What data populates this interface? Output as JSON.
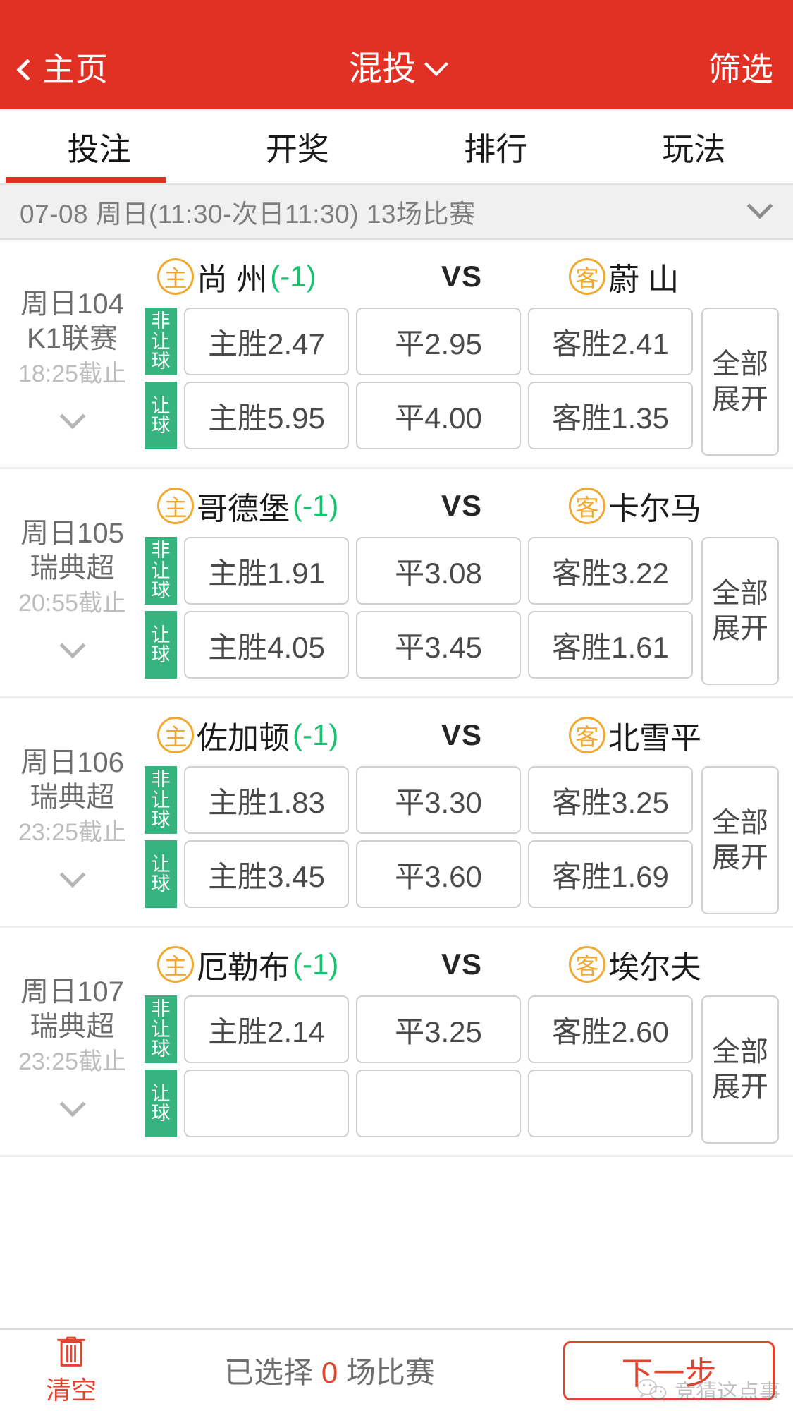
{
  "header": {
    "back_label": "主页",
    "title": "混投",
    "filter_label": "筛选",
    "back_icon": "chevron-left-icon",
    "title_icon": "chevron-down-icon",
    "bg_color": "#e03124"
  },
  "tabs": {
    "items": [
      {
        "label": "投注",
        "active": true
      },
      {
        "label": "开奖",
        "active": false
      },
      {
        "label": "排行",
        "active": false
      },
      {
        "label": "玩法",
        "active": false
      }
    ],
    "active_color": "#e03124"
  },
  "datebar": {
    "text": "07-08 周日(11:30-次日11:30) 13场比赛",
    "icon": "chevron-down-icon"
  },
  "labels": {
    "home_badge": "主",
    "away_badge": "客",
    "vs": "VS",
    "expand_line1": "全部",
    "expand_line2": "展开",
    "tag_nonhandicap": [
      "非",
      "让",
      "球"
    ],
    "tag_handicap": [
      "让",
      "球"
    ]
  },
  "matches": [
    {
      "no": "周日104",
      "league": "K1联赛",
      "cutoff": "18:25截止",
      "home_team": "尚 州",
      "handicap": "(-1)",
      "away_team": "蔚 山",
      "rows": [
        {
          "type": "非让球",
          "home": "主胜2.47",
          "draw": "平2.95",
          "away": "客胜2.41"
        },
        {
          "type": "让球",
          "home": "主胜5.95",
          "draw": "平4.00",
          "away": "客胜1.35"
        }
      ]
    },
    {
      "no": "周日105",
      "league": "瑞典超",
      "cutoff": "20:55截止",
      "home_team": "哥德堡",
      "handicap": "(-1)",
      "away_team": "卡尔马",
      "rows": [
        {
          "type": "非让球",
          "home": "主胜1.91",
          "draw": "平3.08",
          "away": "客胜3.22"
        },
        {
          "type": "让球",
          "home": "主胜4.05",
          "draw": "平3.45",
          "away": "客胜1.61"
        }
      ]
    },
    {
      "no": "周日106",
      "league": "瑞典超",
      "cutoff": "23:25截止",
      "home_team": "佐加顿",
      "handicap": "(-1)",
      "away_team": "北雪平",
      "rows": [
        {
          "type": "非让球",
          "home": "主胜1.83",
          "draw": "平3.30",
          "away": "客胜3.25"
        },
        {
          "type": "让球",
          "home": "主胜3.45",
          "draw": "平3.60",
          "away": "客胜1.69"
        }
      ]
    },
    {
      "no": "周日107",
      "league": "瑞典超",
      "cutoff": "23:25截止",
      "home_team": "厄勒布",
      "handicap": "(-1)",
      "away_team": "埃尔夫",
      "rows": [
        {
          "type": "非让球",
          "home": "主胜2.14",
          "draw": "平3.25",
          "away": "客胜2.60"
        },
        {
          "type": "让球",
          "home": "",
          "draw": "",
          "away": ""
        }
      ]
    }
  ],
  "bottombar": {
    "clear_label": "清空",
    "clear_icon": "trash-icon",
    "selected_prefix": "已选择 ",
    "selected_count": "0",
    "selected_suffix": " 场比赛",
    "next_label": "下一步",
    "watermark_text": "竞猜这点事",
    "watermark_icon": "wechat-icon"
  },
  "colors": {
    "brand_red": "#e03124",
    "accent_red": "#e2452f",
    "tag_green": "#36b37e",
    "handicap_green": "#19c271",
    "badge_orange": "#f0a830"
  }
}
